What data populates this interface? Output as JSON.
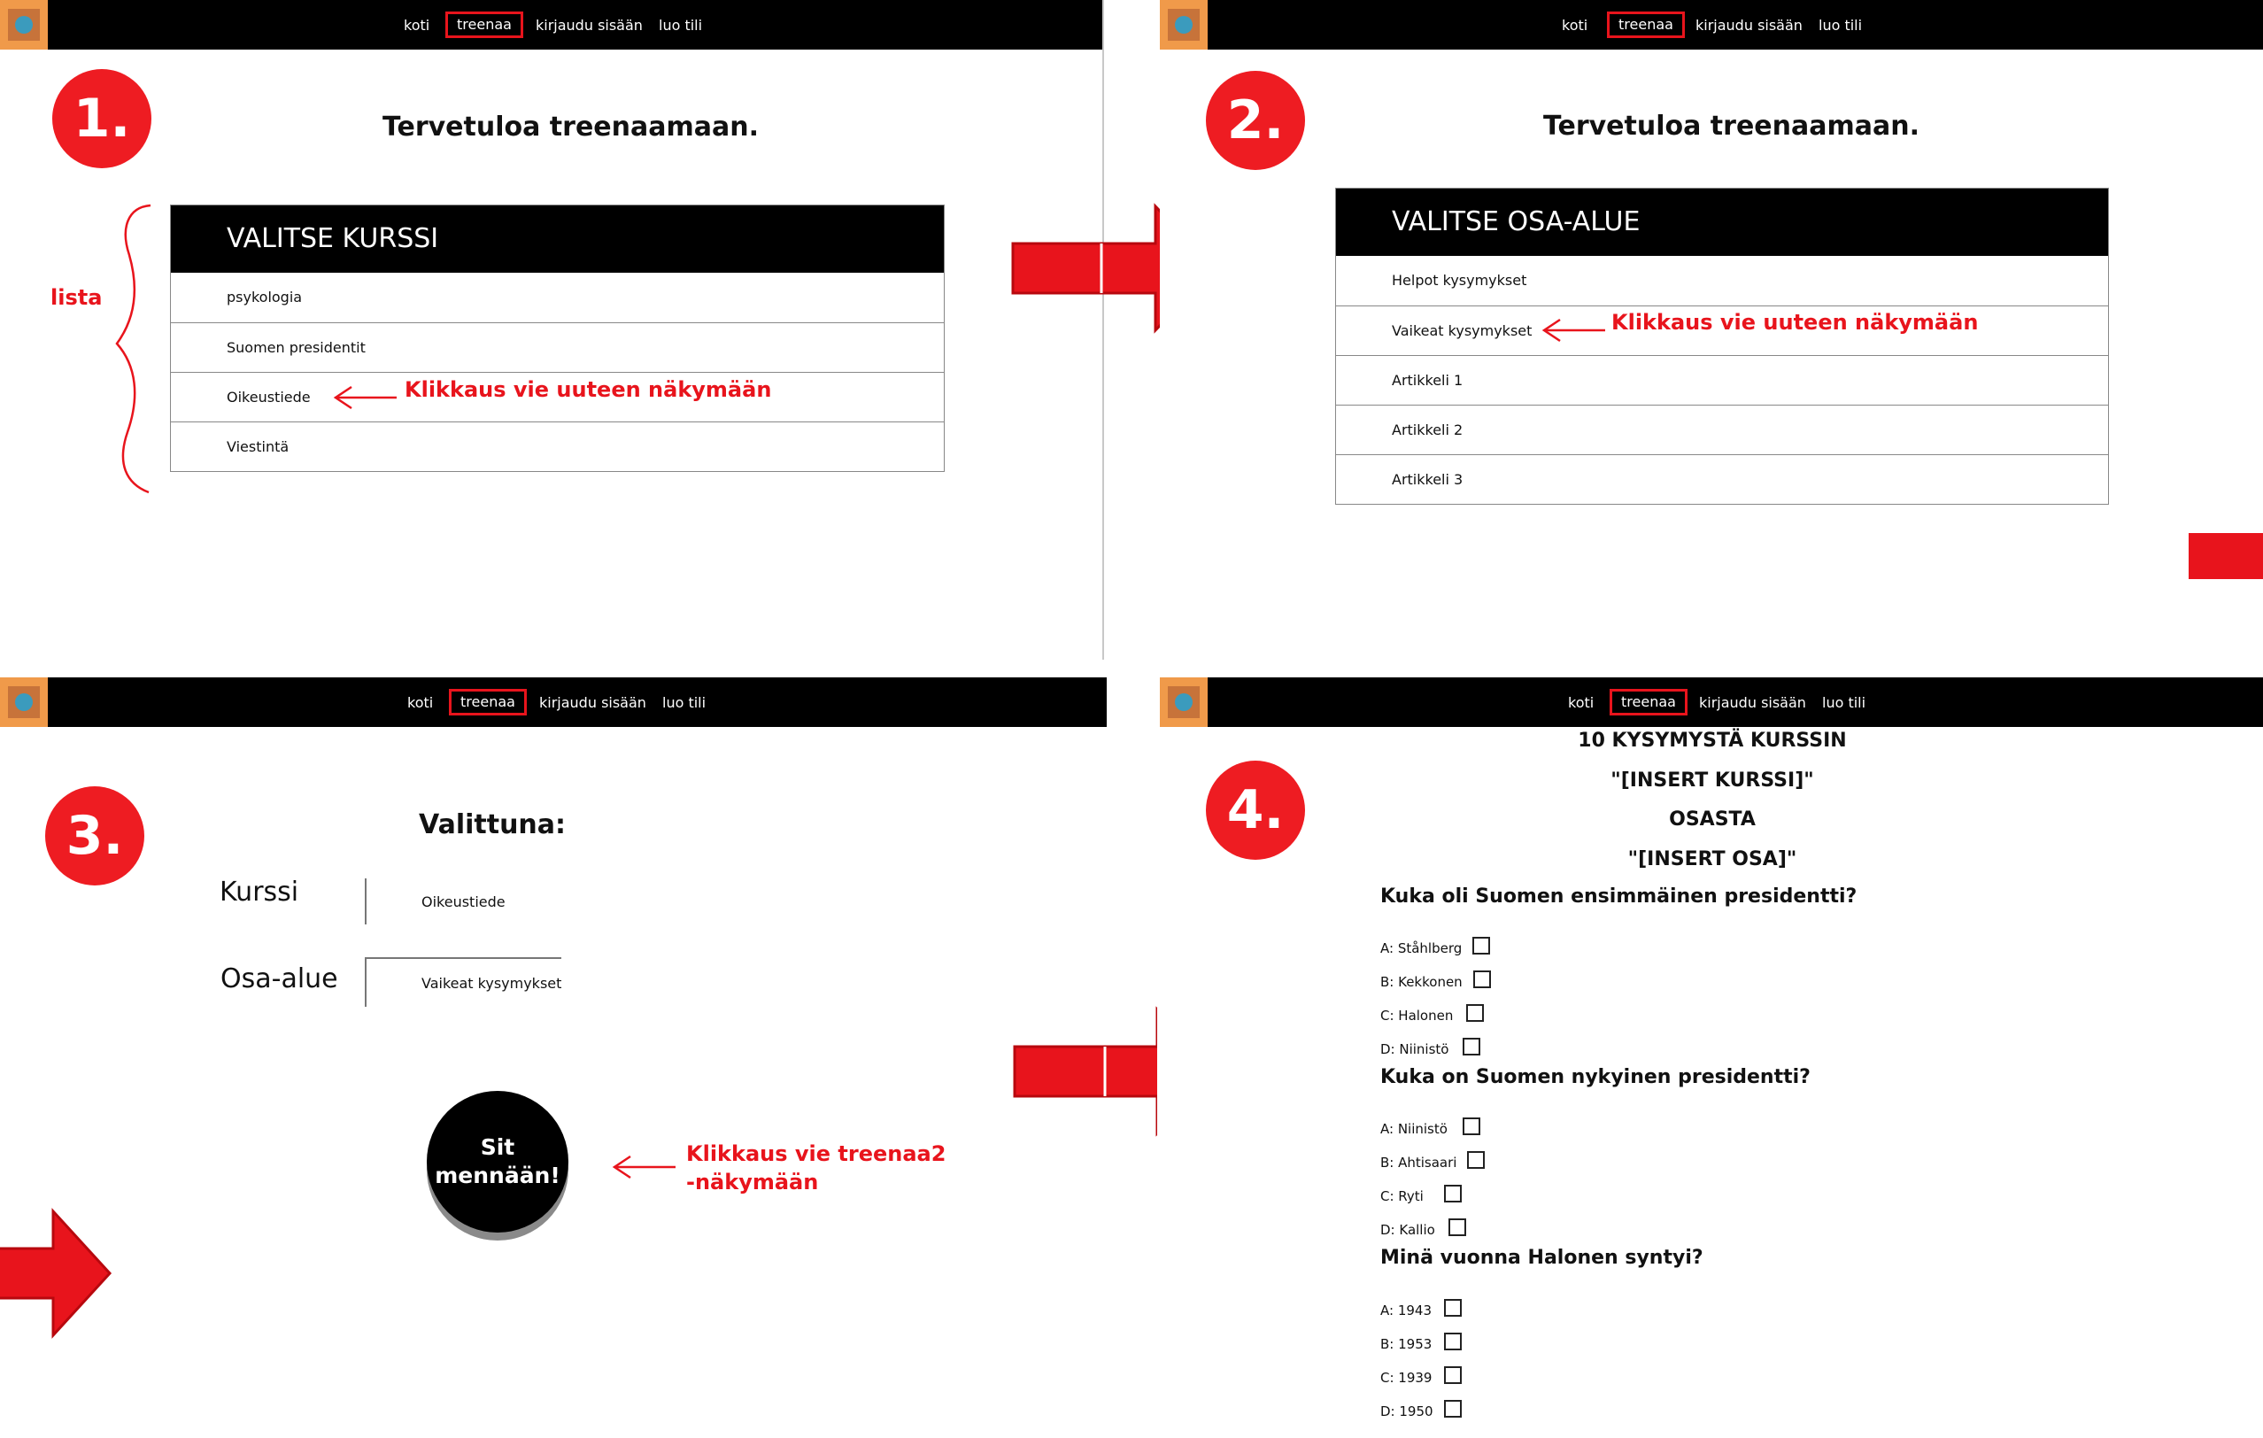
{
  "nav": {
    "items": [
      "koti",
      "treenaa",
      "kirjaudu sisään",
      "luo tili"
    ],
    "active": "treenaa"
  },
  "steps": [
    "1.",
    "2.",
    "3.",
    "4."
  ],
  "panel1": {
    "welcome": "Tervetuloa treenaamaan.",
    "list_title": "VALITSE KURSSI",
    "items": [
      "psykologia",
      "Suomen presidentit",
      "Oikeustiede",
      "Viestintä"
    ],
    "brace_label": "lista",
    "annotation": "Klikkaus vie uuteen näkymään"
  },
  "panel2": {
    "welcome": "Tervetuloa treenaamaan.",
    "list_title": "VALITSE OSA-ALUE",
    "items": [
      "Helpot kysymykset",
      "Vaikeat kysymykset",
      "Artikkeli 1",
      "Artikkeli 2",
      "Artikkeli 3"
    ],
    "annotation": "Klikkaus vie uuteen näkymään"
  },
  "panel3": {
    "heading": "Valittuna:",
    "course_label": "Kurssi",
    "course_value": "Oikeustiede",
    "area_label": "Osa-alue",
    "area_value": "Vaikeat kysymykset",
    "button_line1": "Sit",
    "button_line2": "mennään!",
    "annotation_line1": "Klikkaus vie treenaa2",
    "annotation_line2": "-näkymään"
  },
  "panel4": {
    "header_lines": [
      "10 KYSYMYSTÄ KURSSIN",
      "\"[INSERT KURSSI]\"",
      "OSASTA",
      "\"[INSERT OSA]\""
    ],
    "questions": [
      {
        "text": "Kuka oli Suomen ensimmäinen presidentti?",
        "options": [
          "A: Ståhlberg",
          "B: Kekkonen",
          "C: Halonen",
          "D: Niinistö"
        ]
      },
      {
        "text": "Kuka on Suomen nykyinen presidentti?",
        "options": [
          "A: Niinistö",
          "B: Ahtisaari",
          "C: Ryti",
          "D: Kallio"
        ]
      },
      {
        "text": "Minä vuonna Halonen syntyi?",
        "options": [
          "A: 1943",
          "B: 1953",
          "C: 1939",
          "D: 1950"
        ]
      }
    ]
  },
  "colors": {
    "accent_red": "#ee1c22",
    "nav_bg": "#000000",
    "logo_orange": "#f09a4a",
    "logo_blue": "#3b9bbd"
  }
}
